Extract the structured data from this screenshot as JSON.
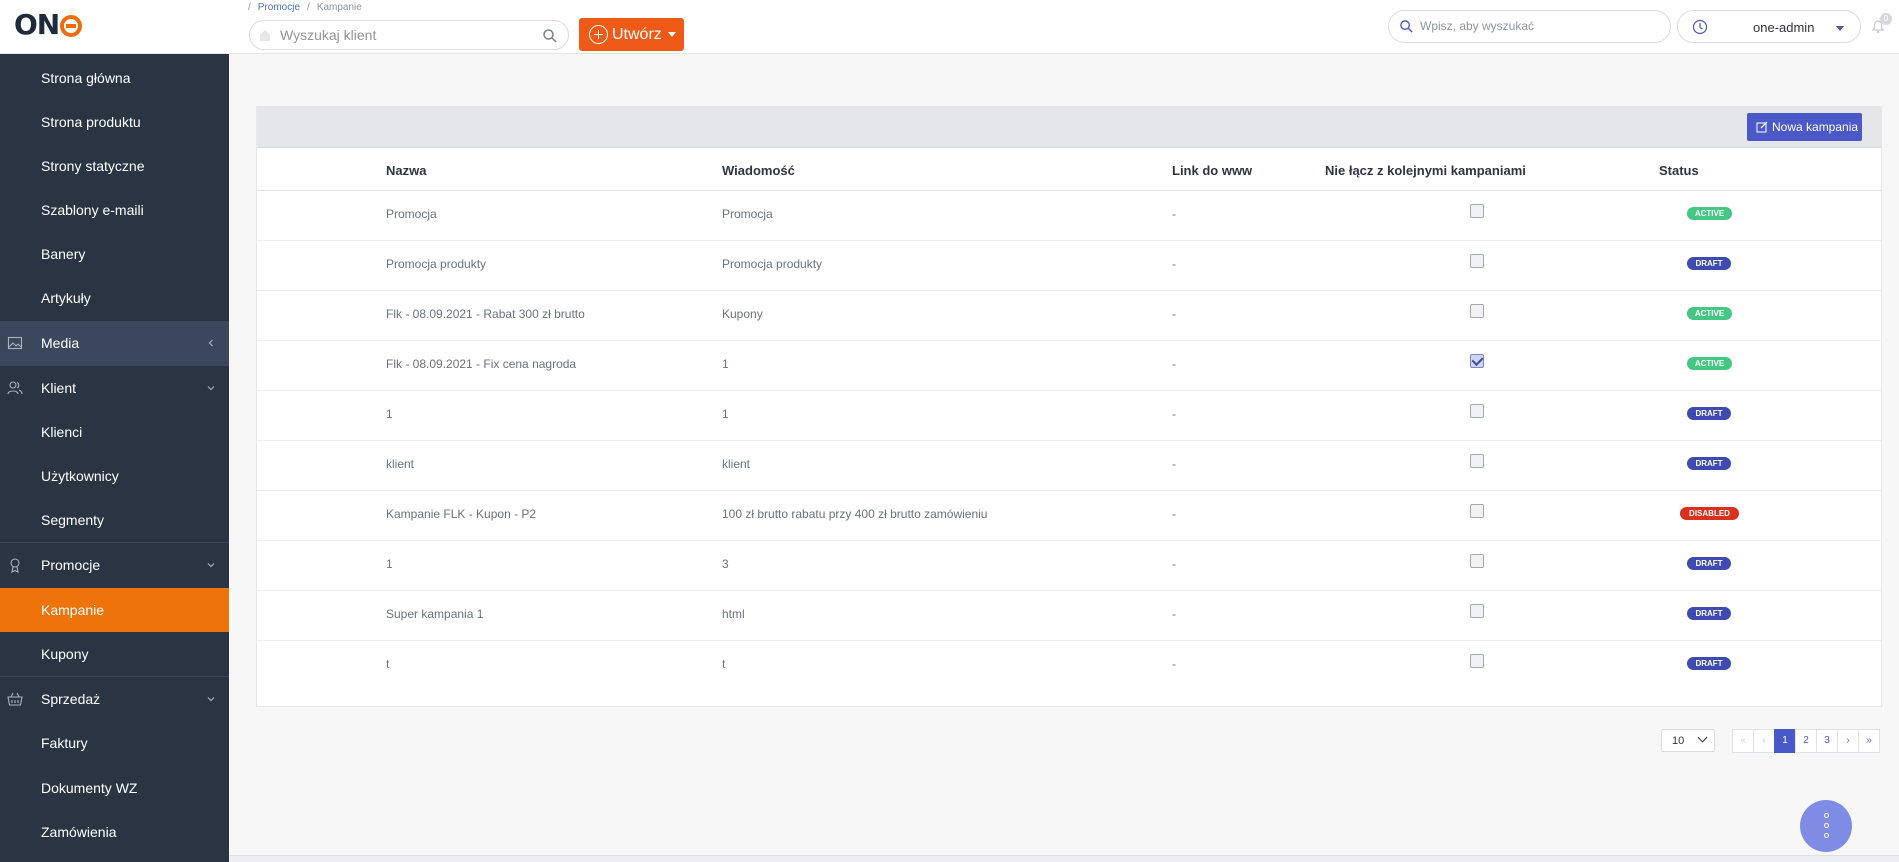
{
  "app": {
    "logo": "ON"
  },
  "breadcrumb": {
    "parent": "Promocje",
    "current": "Kampanie"
  },
  "client_search": {
    "placeholder": "Wyszukaj klient"
  },
  "create_button": {
    "label": "Utwórz"
  },
  "global_search": {
    "placeholder": "Wpisz, aby wyszukać"
  },
  "user": {
    "name": "one-admin"
  },
  "notifications": {
    "count": "0"
  },
  "sidebar": {
    "items": [
      {
        "label": "Strona główna"
      },
      {
        "label": "Strona produktu"
      },
      {
        "label": "Strony statyczne"
      },
      {
        "label": "Szablony e-maili"
      },
      {
        "label": "Banery"
      },
      {
        "label": "Artykuły"
      },
      {
        "label": "Media",
        "icon": "image-icon",
        "expanded": false
      },
      {
        "label": "Klient",
        "icon": "users-icon",
        "expanded": true
      },
      {
        "label": "Klienci"
      },
      {
        "label": "Użytkownicy"
      },
      {
        "label": "Segmenty"
      },
      {
        "label": "Promocje",
        "icon": "award-icon",
        "expanded": true
      },
      {
        "label": "Kampanie",
        "active": true
      },
      {
        "label": "Kupony"
      },
      {
        "label": "Sprzedaż",
        "icon": "basket-icon",
        "expanded": true
      },
      {
        "label": "Faktury"
      },
      {
        "label": "Dokumenty WZ"
      },
      {
        "label": "Zamówienia"
      }
    ]
  },
  "table": {
    "new_button": "Nowa kampania",
    "headers": {
      "name": "Nazwa",
      "message": "Wiadomość",
      "link": "Link do www",
      "no_combine": "Nie łącz z kolejnymi kampaniami",
      "status": "Status"
    },
    "rows": [
      {
        "name": "Promocja",
        "message": "Promocja",
        "link": "-",
        "no_combine": false,
        "status": "ACTIVE"
      },
      {
        "name": "Promocja produkty",
        "message": "Promocja produkty",
        "link": "-",
        "no_combine": false,
        "status": "DRAFT"
      },
      {
        "name": "Flk - 08.09.2021 - Rabat 300 zł brutto",
        "message": "Kupony",
        "link": "-",
        "no_combine": false,
        "status": "ACTIVE"
      },
      {
        "name": "Flk - 08.09.2021 - Fix cena nagroda",
        "message": "1",
        "link": "-",
        "no_combine": true,
        "status": "ACTIVE"
      },
      {
        "name": "1",
        "message": "1",
        "link": "-",
        "no_combine": false,
        "status": "DRAFT"
      },
      {
        "name": "klient",
        "message": "klient",
        "link": "-",
        "no_combine": false,
        "status": "DRAFT"
      },
      {
        "name": "Kampanie FLK - Kupon - P2",
        "message": "100 zł brutto rabatu przy 400 zł brutto zamówieniu",
        "link": "-",
        "no_combine": false,
        "status": "DISABLED"
      },
      {
        "name": "1",
        "message": "3",
        "link": "-",
        "no_combine": false,
        "status": "DRAFT"
      },
      {
        "name": "Super kampania 1",
        "message": "html",
        "link": "-",
        "no_combine": false,
        "status": "DRAFT"
      },
      {
        "name": "t",
        "message": "t",
        "link": "-",
        "no_combine": false,
        "status": "DRAFT"
      }
    ]
  },
  "pagination": {
    "per_page": "10",
    "first": "«",
    "prev": "‹",
    "pages": [
      "1",
      "2",
      "3"
    ],
    "current": "1",
    "next": "›",
    "last": "»"
  },
  "colors": {
    "accent": "#ef730b",
    "primary": "#4a58c8",
    "sidebar": "#2b3443",
    "active": "#43c783",
    "draft": "#3f4ab2",
    "disabled": "#d9311b"
  }
}
